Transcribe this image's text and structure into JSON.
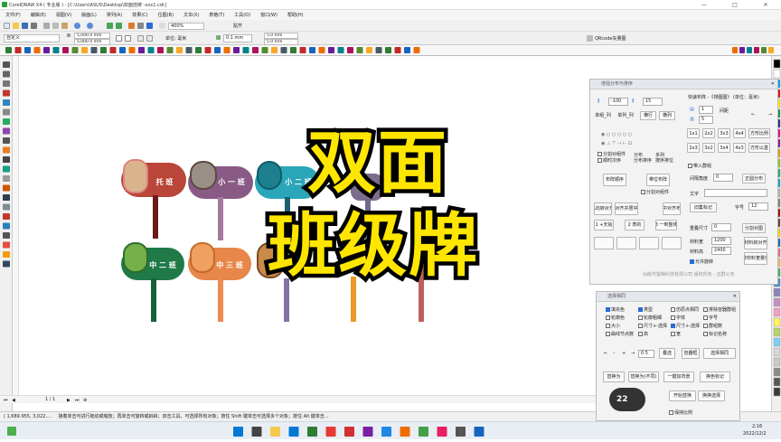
{
  "titlebar": {
    "title": "CorelDRAW X4 ( 专业版 ) - [C:\\Users\\ASUS\\Desktop\\双面挂牌 -xxx1.cdr]",
    "controls": [
      "—",
      "□",
      "✕"
    ]
  },
  "menu": [
    "文件(F)",
    "编辑(E)",
    "视图(V)",
    "版面(L)",
    "排列(A)",
    "效果(C)",
    "位图(B)",
    "文本(X)",
    "表格(T)",
    "工具(O)",
    "窗口(W)",
    "帮助(H)"
  ],
  "toolbar": {
    "zoom": "400%",
    "snap": "贴齐"
  },
  "propbar": {
    "preset": "自定义",
    "width": "5,000.0 mm",
    "height": "5,000.0 mm",
    "unit": "单位: 毫米",
    "nudge": "0.1 mm",
    "dup_x": "5.0 mm",
    "dup_y": "5.0 mm",
    "plugin": "QRcode矢量图"
  },
  "overlay": {
    "line1": "双面",
    "line2": "班级牌"
  },
  "signs": {
    "top": [
      "托 班",
      "小 一 班",
      "小 二 班"
    ],
    "bottom": [
      "中 二 班",
      "中 三 班"
    ]
  },
  "pagebar": {
    "page": "1 / 1"
  },
  "status": {
    "coords": "( 1,689.955, 3,022....",
    "hint": "接着单击可进行拖动或缩放；再单击可旋转或斜斜；双击工具，可选择所有对象；按住 Shift 键单击可选择多个对象；按住 Alt 键单击..."
  },
  "panel1": {
    "title": "增强分布与排序",
    "v1": "-100",
    "v2": "15",
    "quick_title": "快速布阵 -《排图图》 (单位：毫米)",
    "rows": "1",
    "cols": "5",
    "row_gap_label": "间距",
    "tabs": [
      "单组_列",
      "单列_列",
      "横行",
      "横列"
    ],
    "opts": [
      "分割对组件",
      "顺时次序",
      "分布",
      "分布排序",
      "多列",
      "按序排位"
    ],
    "btns_a": [
      "布阵顺序",
      "带位布阵"
    ],
    "chk_split": "分割对组件",
    "grid": [
      "1x1",
      "2x2",
      "3x3",
      "4x4",
      "2x3",
      "3x2",
      "3x4",
      "4x3"
    ],
    "right_btns": [
      "方形比例",
      "方形以基"
    ],
    "chk_group": "带入群组",
    "angle_label": "间隔角度",
    "angle_val": "0",
    "right_btn3": "正圆分布",
    "text_label": "文字",
    "dup_btn": "旧集标记",
    "font_label": "字号",
    "font_val": "12",
    "rows2": [
      "A向转对齐",
      "以前对齐并居中间距",
      "居中对齐布阵",
      "1 +天始",
      "2 表的",
      "3 一到整体"
    ],
    "size_label": "重叠尺寸",
    "size_val": "0",
    "split_btn": "分割对图",
    "wide_label": "材料宽",
    "wide_val": "1200",
    "high_label": "材料高",
    "high_val": "2400",
    "mat_btns": [
      "材料转对齐",
      "按材料宽量值"
    ],
    "allow_chk": "允许旋转",
    "footer": "仙桃市蜀嗨科技有限公司 版权所有 - 这群公务"
  },
  "panel2": {
    "title": "选择相同",
    "checks": [
      "填充色",
      "类型",
      "仿原点相同",
      "排除容器群组",
      "轮廓色",
      "轮廓粗细",
      "字体",
      "字号",
      "大小",
      "尺寸+-选择",
      "尺寸+-选择",
      "群组数",
      "曲线节点数",
      "高",
      "宽",
      "标记名称"
    ],
    "val": "0.5",
    "btns": [
      "叠选",
      "容器框",
      "选择相同"
    ],
    "btns2": [
      "替换为",
      "替换为(不同)",
      "一键加背景",
      "换色标记"
    ],
    "btns3": [
      "",
      "开始替换",
      "换换选择"
    ],
    "chk_ratio": "保持比例",
    "bubble": "22"
  },
  "taskbar": {
    "time": "2:16",
    "date": "2022/12/2"
  }
}
